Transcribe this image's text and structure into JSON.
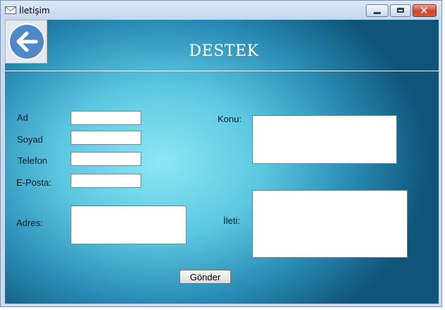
{
  "window": {
    "title": "İletişim",
    "controls": {
      "minimize": "minimize",
      "maximize": "maximize",
      "close": "✕"
    }
  },
  "header": {
    "title": "DESTEK"
  },
  "form": {
    "left": {
      "ad_label": "Ad",
      "ad_value": "",
      "soyad_label": "Soyad",
      "soyad_value": "",
      "telefon_label": "Telefon",
      "telefon_value": "",
      "eposta_label": "E-Posta:",
      "eposta_value": "",
      "adres_label": "Adres:",
      "adres_value": ""
    },
    "right": {
      "konu_label": "Konu:",
      "konu_value": "",
      "ileti_label": "İleti:",
      "ileti_value": ""
    },
    "send_label": "Gönder"
  },
  "colors": {
    "accent": "#4f88c9",
    "background": "#2a8db5"
  }
}
